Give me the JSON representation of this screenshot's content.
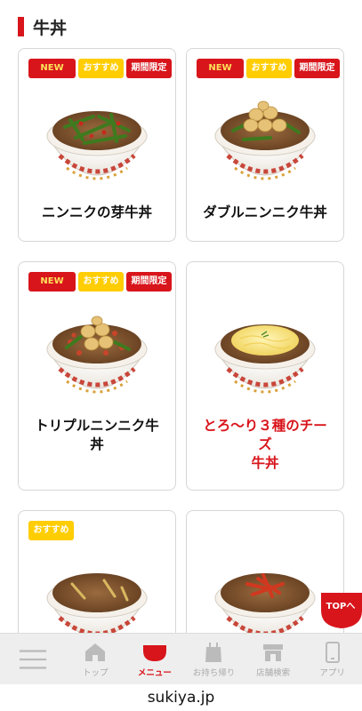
{
  "section": {
    "title": "牛丼"
  },
  "badges": {
    "new": "NEW",
    "recommended": "おすすめ",
    "limited": "期間限定"
  },
  "cards": [
    {
      "name_line1": "ニンニクの芽牛丼",
      "name_line2": "",
      "name_line3": "",
      "highlight": false
    },
    {
      "name_line1": "ダブルニンニク牛丼",
      "name_line2": "",
      "name_line3": "",
      "highlight": false
    },
    {
      "name_line1": "トリプルニンニク牛",
      "name_line2": "丼",
      "name_line3": "",
      "highlight": false
    },
    {
      "name_line1": "とろ〜り３種のチー",
      "name_line2": "ズ",
      "name_line3": "牛丼",
      "highlight": true
    },
    {
      "name_line1": "",
      "name_line2": "",
      "name_line3": "",
      "highlight": false
    },
    {
      "name_line1": "",
      "name_line2": "",
      "name_line3": "",
      "highlight": false
    }
  ],
  "top_button": {
    "label": "TOPへ"
  },
  "tabbar": {
    "items": [
      {
        "label": "",
        "icon": "hamburger-icon"
      },
      {
        "label": "トップ",
        "icon": "home-icon"
      },
      {
        "label": "メニュー",
        "icon": "bowl-icon"
      },
      {
        "label": "お持ち帰り",
        "icon": "takeout-bag-icon"
      },
      {
        "label": "店舗検索",
        "icon": "store-icon"
      },
      {
        "label": "アプリ",
        "icon": "smartphone-icon"
      }
    ]
  },
  "browser": {
    "url": "sukiya.jp"
  },
  "colors": {
    "brand_red": "#d8151b",
    "badge_yellow": "#ffcd00"
  }
}
